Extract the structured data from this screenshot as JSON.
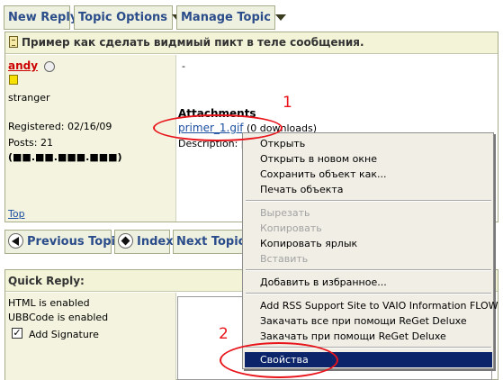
{
  "toolbar": {
    "new_reply": "New Reply",
    "topic_options": "Topic Options",
    "manage_topic": "Manage Topic"
  },
  "post": {
    "title": "Пример как сделать видмиый пикт в теле сообщения.",
    "author": "andy",
    "rank": "stranger",
    "registered": "Registered: 02/16/09",
    "posts": "Posts: 21",
    "ip": "(■■.■■.■■■.■■■)",
    "top_link": "Top",
    "body_text": "-",
    "attachments_label": "Attachments",
    "attachment_name": "primer_1.gif",
    "attachment_downloads": "(0 downloads)",
    "description_label": "Description: p"
  },
  "nav": {
    "previous": "Previous Topic",
    "index": "Index",
    "next": "Next Topic"
  },
  "quick_reply": {
    "title": "Quick Reply:",
    "html_status": "HTML is enabled",
    "ubb_status": "UBBCode is enabled",
    "add_signature": "Add Signature",
    "add_signature_checked": true
  },
  "context_menu": {
    "items": [
      {
        "label": "Открыть",
        "disabled": false
      },
      {
        "label": "Открыть в новом окне",
        "disabled": false
      },
      {
        "label": "Сохранить объект как...",
        "disabled": false
      },
      {
        "label": "Печать объекта",
        "disabled": false
      },
      {
        "label": "Вырезать",
        "disabled": true
      },
      {
        "label": "Копировать",
        "disabled": true
      },
      {
        "label": "Копировать ярлык",
        "disabled": false
      },
      {
        "label": "Вставить",
        "disabled": true
      },
      {
        "label": "Добавить в избранное...",
        "disabled": false
      },
      {
        "label": "Add RSS Support Site to VAIO Information FLOW",
        "disabled": false
      },
      {
        "label": "Закачать все при помощи ReGet Deluxe",
        "disabled": false
      },
      {
        "label": "Закачать при помощи ReGet Deluxe",
        "disabled": false
      },
      {
        "label": "Свойства",
        "disabled": false,
        "selected": true
      }
    ]
  },
  "annotations": {
    "marker1": "1",
    "marker2": "2"
  },
  "colors": {
    "annotation": "#e8141a",
    "menu_highlight": "#0b246a",
    "button_text": "#2a4c8a",
    "author": "#cc0000"
  }
}
